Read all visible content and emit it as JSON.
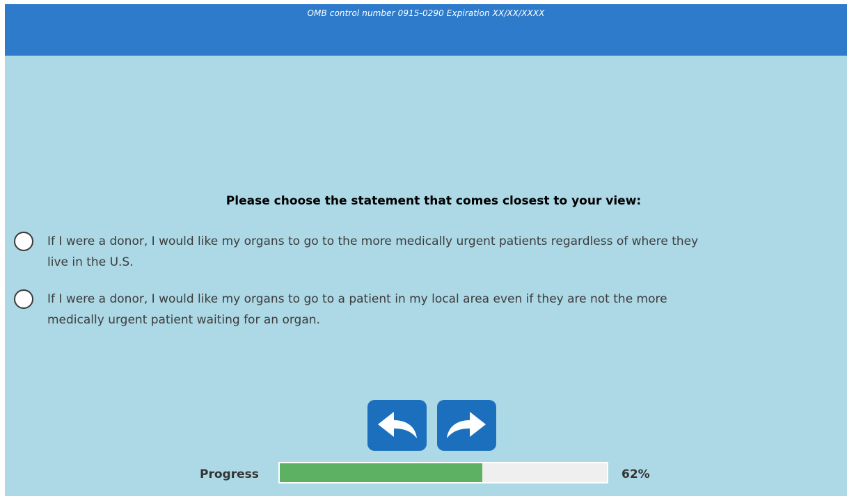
{
  "header": {
    "omb_text": "OMB control number 0915-0290 Expiration XX/XX/XXXX"
  },
  "question": {
    "text": "Please choose the statement that comes closest to your view:",
    "options": [
      {
        "line1": "If I were a donor, I would like my organs to go to the more medically urgent patients regardless of where they",
        "line2": "live in the U.S.",
        "selected": false
      },
      {
        "line1": "If I were a donor, I would like my organs to go to a patient in my local area even if they are not the more",
        "line2": "medically urgent patient waiting for an organ.",
        "selected": false
      }
    ]
  },
  "navigation": {
    "back_icon": "back-arrow-icon",
    "next_icon": "forward-arrow-icon"
  },
  "progress": {
    "label": "Progress",
    "percent_text": "62%",
    "fraction": 0.62
  },
  "colors": {
    "header": "#2e7bcb",
    "background": "#add8e6",
    "button": "#1b6fbc",
    "progress_fill": "#5cb262",
    "progress_track": "#efefef"
  }
}
